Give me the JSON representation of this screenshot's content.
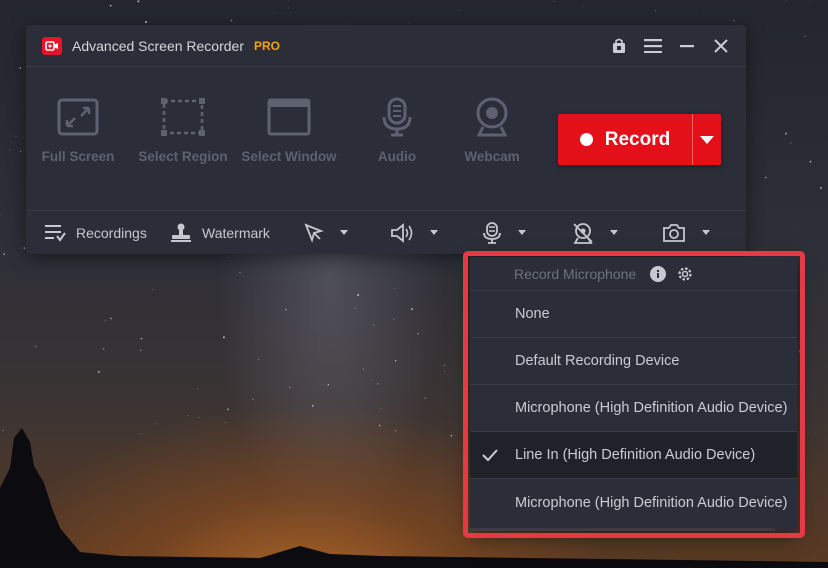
{
  "window": {
    "title": "Advanced Screen Recorder",
    "badge": "PRO",
    "controls": [
      "upgrade-icon",
      "menu-icon",
      "minimize-icon",
      "close-icon"
    ]
  },
  "modes": [
    {
      "label": "Full Screen",
      "icon": "full-screen-icon"
    },
    {
      "label": "Select Region",
      "icon": "select-region-icon"
    },
    {
      "label": "Select Window",
      "icon": "select-window-icon"
    },
    {
      "label": "Audio",
      "icon": "microphone-icon"
    },
    {
      "label": "Webcam",
      "icon": "webcam-icon"
    }
  ],
  "record": {
    "label": "Record",
    "color": "#e3101a"
  },
  "toolbar": {
    "recordings_label": "Recordings",
    "watermark_label": "Watermark"
  },
  "dropdown": {
    "header": "Record Microphone",
    "items": [
      {
        "label": "None",
        "selected": false
      },
      {
        "label": "Default Recording Device",
        "selected": false
      },
      {
        "label": "Microphone (High Definition Audio Device)",
        "selected": false
      },
      {
        "label": "Line In (High Definition Audio Device)",
        "selected": true
      },
      {
        "label": "Microphone (High Definition Audio Device)",
        "selected": false
      }
    ],
    "highlight_color": "#e53a45"
  }
}
